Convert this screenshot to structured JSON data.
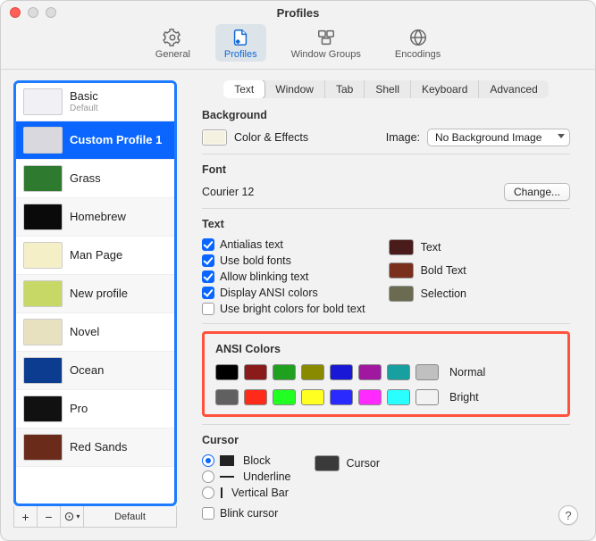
{
  "window": {
    "title": "Profiles"
  },
  "toolbar": {
    "items": [
      "General",
      "Profiles",
      "Window Groups",
      "Encodings"
    ],
    "selected": "Profiles"
  },
  "sidebar": {
    "profiles": [
      {
        "name": "Basic",
        "subtitle": "Default",
        "thumb_bg": "#f0f0f5"
      },
      {
        "name": "Custom Profile 1",
        "thumb_bg": "#d8d8de"
      },
      {
        "name": "Grass",
        "thumb_bg": "#2e7a2e"
      },
      {
        "name": "Homebrew",
        "thumb_bg": "#0a0a0a"
      },
      {
        "name": "Man Page",
        "thumb_bg": "#f5efc8"
      },
      {
        "name": "New profile",
        "thumb_bg": "#c7d866"
      },
      {
        "name": "Novel",
        "thumb_bg": "#e8e1c0"
      },
      {
        "name": "Ocean",
        "thumb_bg": "#0b3c8f"
      },
      {
        "name": "Pro",
        "thumb_bg": "#111111"
      },
      {
        "name": "Red Sands",
        "thumb_bg": "#6b2b1a"
      }
    ],
    "selected_index": 1,
    "footer": {
      "add": "+",
      "remove": "−",
      "menu": "⊙",
      "default_label": "Default"
    }
  },
  "tabs": {
    "items": [
      "Text",
      "Window",
      "Tab",
      "Shell",
      "Keyboard",
      "Advanced"
    ],
    "selected": "Text"
  },
  "background": {
    "heading": "Background",
    "color_label": "Color & Effects",
    "image_label": "Image:",
    "image_popup": "No Background Image"
  },
  "font": {
    "heading": "Font",
    "current": "Courier 12",
    "change_btn": "Change..."
  },
  "text": {
    "heading": "Text",
    "options": [
      {
        "label": "Antialias text",
        "checked": true
      },
      {
        "label": "Use bold fonts",
        "checked": true
      },
      {
        "label": "Allow blinking text",
        "checked": true
      },
      {
        "label": "Display ANSI colors",
        "checked": true
      },
      {
        "label": "Use bright colors for bold text",
        "checked": false
      }
    ],
    "swatches": [
      {
        "label": "Text",
        "color": "#4a1b1b"
      },
      {
        "label": "Bold Text",
        "color": "#7a2f1c"
      },
      {
        "label": "Selection",
        "color": "#6b6b52"
      }
    ]
  },
  "ansi": {
    "heading": "ANSI Colors",
    "normal_label": "Normal",
    "bright_label": "Bright",
    "normal": [
      "#000000",
      "#8b1a1a",
      "#1fa01f",
      "#8a8a00",
      "#1818d6",
      "#a018a0",
      "#18a0a0",
      "#c0c0c0"
    ],
    "bright": [
      "#606060",
      "#ff2b1a",
      "#22ff22",
      "#ffff22",
      "#2a2aff",
      "#ff2aff",
      "#2affff",
      "#f2f2f2"
    ]
  },
  "cursor": {
    "heading": "Cursor",
    "options": [
      {
        "label": "Block",
        "checked": true,
        "style": "block"
      },
      {
        "label": "Underline",
        "checked": false,
        "style": "underline"
      },
      {
        "label": "Vertical Bar",
        "checked": false,
        "style": "bar"
      }
    ],
    "blink_label": "Blink cursor",
    "blink_checked": false,
    "swatch_label": "Cursor",
    "swatch_color": "#3a3a3a"
  },
  "help": "?"
}
